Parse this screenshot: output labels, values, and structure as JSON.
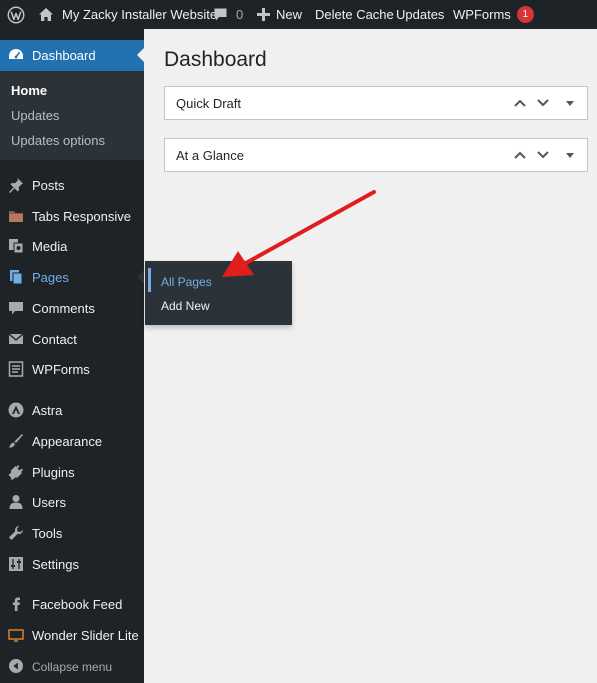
{
  "admin_bar": {
    "site_name": "My Zacky Installer Website",
    "comments_count": "0",
    "new_label": "New",
    "delete_cache_label": "Delete Cache",
    "updates_label": "Updates",
    "wpforms_label": "WPForms",
    "wpforms_badge": "1"
  },
  "sidebar": {
    "dashboard": "Dashboard",
    "dashboard_sub": [
      "Home",
      "Updates",
      "Updates options"
    ],
    "items": {
      "posts": "Posts",
      "tabs": "Tabs Responsive",
      "media": "Media",
      "pages": "Pages",
      "comments": "Comments",
      "contact": "Contact",
      "wpforms": "WPForms",
      "astra": "Astra",
      "appearance": "Appearance",
      "plugins": "Plugins",
      "users": "Users",
      "tools": "Tools",
      "settings": "Settings",
      "facebook": "Facebook Feed",
      "wonder": "Wonder Slider Lite"
    },
    "collapse": "Collapse menu"
  },
  "pages_flyout": [
    "All Pages",
    "Add New"
  ],
  "main": {
    "title": "Dashboard",
    "widgets": [
      "Quick Draft",
      "At a Glance"
    ]
  },
  "colors": {
    "admin_bg": "#1d2327",
    "submenu_bg": "#2c3338",
    "accent": "#2271b1",
    "link_highlight": "#72aee6",
    "badge": "#d63638",
    "annotation_arrow": "#e01e1e",
    "page_bg": "#f0f0f1"
  },
  "icons": [
    "wordpress-logo",
    "home",
    "comment-bubble",
    "plus",
    "dashboard-gauge",
    "pushpin",
    "folder",
    "media",
    "pages",
    "comment",
    "envelope",
    "form",
    "astra-logo",
    "paintbrush",
    "plug",
    "user",
    "wrench",
    "settings-sliders",
    "facebook",
    "slider",
    "collapse-arrow",
    "chevron-up",
    "chevron-down",
    "triangle-down"
  ]
}
